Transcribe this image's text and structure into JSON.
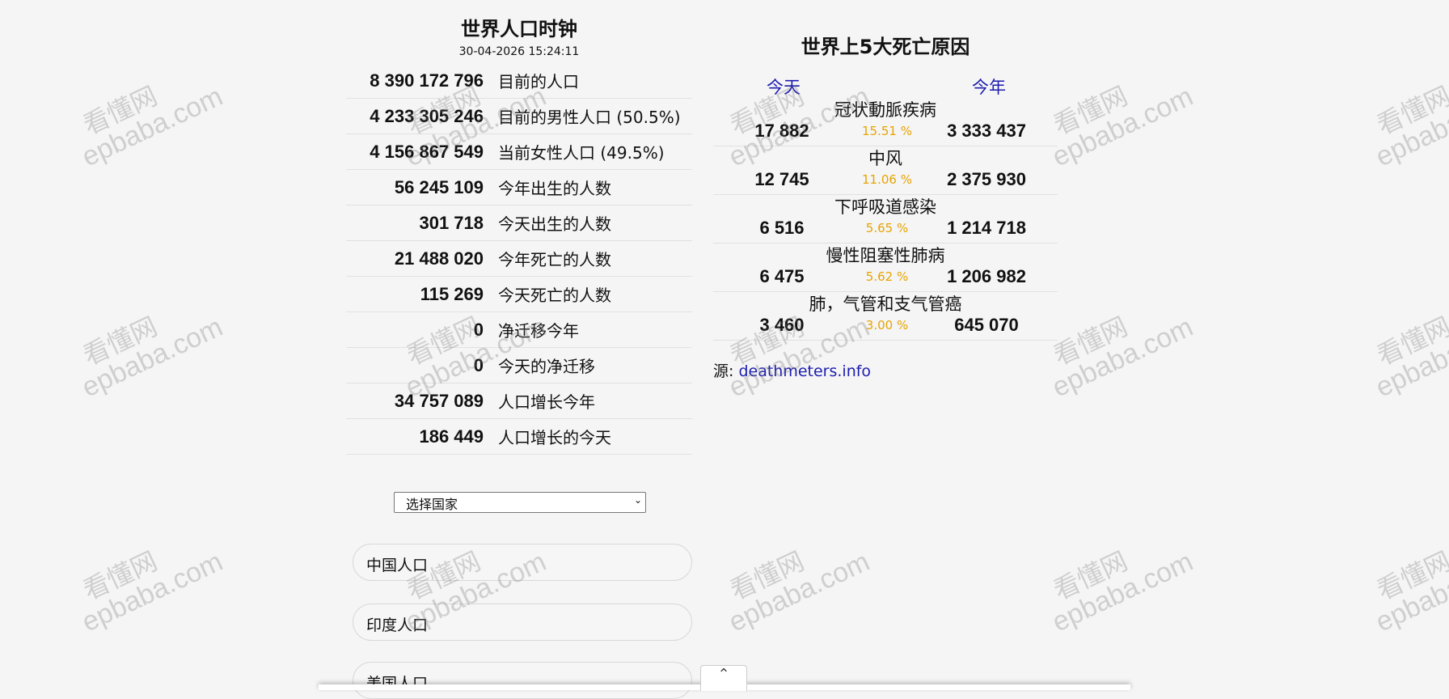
{
  "left": {
    "title": "世界人口时钟",
    "datetime": "30-04-2026 15:24:11",
    "stats": [
      {
        "value": "8 390 172 796",
        "label": "目前的人口"
      },
      {
        "value": "4 233 305 246",
        "label": "目前的男性人口 (50.5%)"
      },
      {
        "value": "4 156 867 549",
        "label": "当前女性人口 (49.5%)"
      },
      {
        "value": "56 245 109",
        "label": "今年出生的人数"
      },
      {
        "value": "301 718",
        "label": "今天出生的人数"
      },
      {
        "value": "21 488 020",
        "label": "今年死亡的人数"
      },
      {
        "value": "115 269",
        "label": "今天死亡的人数"
      },
      {
        "value": "0",
        "label": "净迁移今年"
      },
      {
        "value": "0",
        "label": "今天的净迁移"
      },
      {
        "value": "34 757 089",
        "label": "人口增长今年"
      },
      {
        "value": "186 449",
        "label": "人口增长的今天"
      }
    ],
    "country_select": "选择国家",
    "country_links": [
      "中国人口",
      "印度人口",
      "美国人口"
    ]
  },
  "right": {
    "title": "世界上5大死亡原因",
    "header_today": "今天",
    "header_year": "今年",
    "causes": [
      {
        "name": "冠状動脈疾病",
        "today": "17 882",
        "pct": "15.51 %",
        "year": "3 333 437"
      },
      {
        "name": "中风",
        "today": "12 745",
        "pct": "11.06 %",
        "year": "2 375 930"
      },
      {
        "name": "下呼吸道感染",
        "today": "6 516",
        "pct": "5.65 %",
        "year": "1 214 718"
      },
      {
        "name": "慢性阻塞性肺病",
        "today": "6 475",
        "pct": "5.62 %",
        "year": "1 206 982"
      },
      {
        "name": "肺，气管和支气管癌",
        "today": "3 460",
        "pct": "3.00 %",
        "year": "645 070"
      }
    ],
    "source_label": "源:",
    "source_link": "deathmeters.info"
  },
  "watermark": {
    "line1": "看懂网",
    "line2": "epbaba.com"
  },
  "colors": {
    "link": "#1c1cb0",
    "percent": "#e6a400",
    "background": "#f5f5f5"
  },
  "icons": {
    "select_arrow": "chevron-down-icon",
    "scroll_top": "chevron-up-icon"
  }
}
